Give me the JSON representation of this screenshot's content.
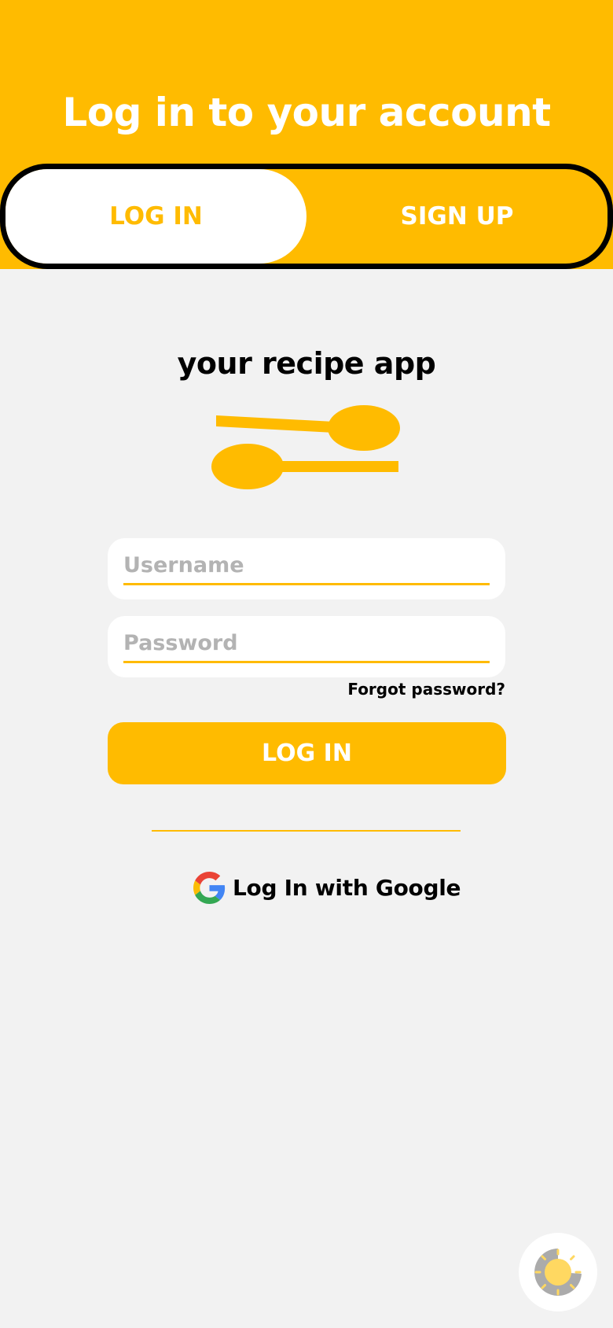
{
  "header": {
    "title": "Log in to your account"
  },
  "tabs": [
    {
      "label": "LOG IN",
      "active": true
    },
    {
      "label": "SIGN UP",
      "active": false
    }
  ],
  "brand": {
    "app_name": "your recipe app",
    "logo_icon": "spoons-icon"
  },
  "form": {
    "username": {
      "placeholder": "Username",
      "value": ""
    },
    "password": {
      "placeholder": "Password",
      "value": ""
    },
    "forgot_label": "Forgot password?",
    "submit_label": "LOG IN"
  },
  "social": {
    "google_label": "Log In with Google",
    "icon": "google-icon"
  },
  "theme_toggle": {
    "icon": "sun-moon-icon"
  },
  "colors": {
    "accent": "#ffbb00",
    "background": "#f2f2f2",
    "surface": "#ffffff",
    "text": "#000000",
    "placeholder": "#b3b3b3"
  }
}
